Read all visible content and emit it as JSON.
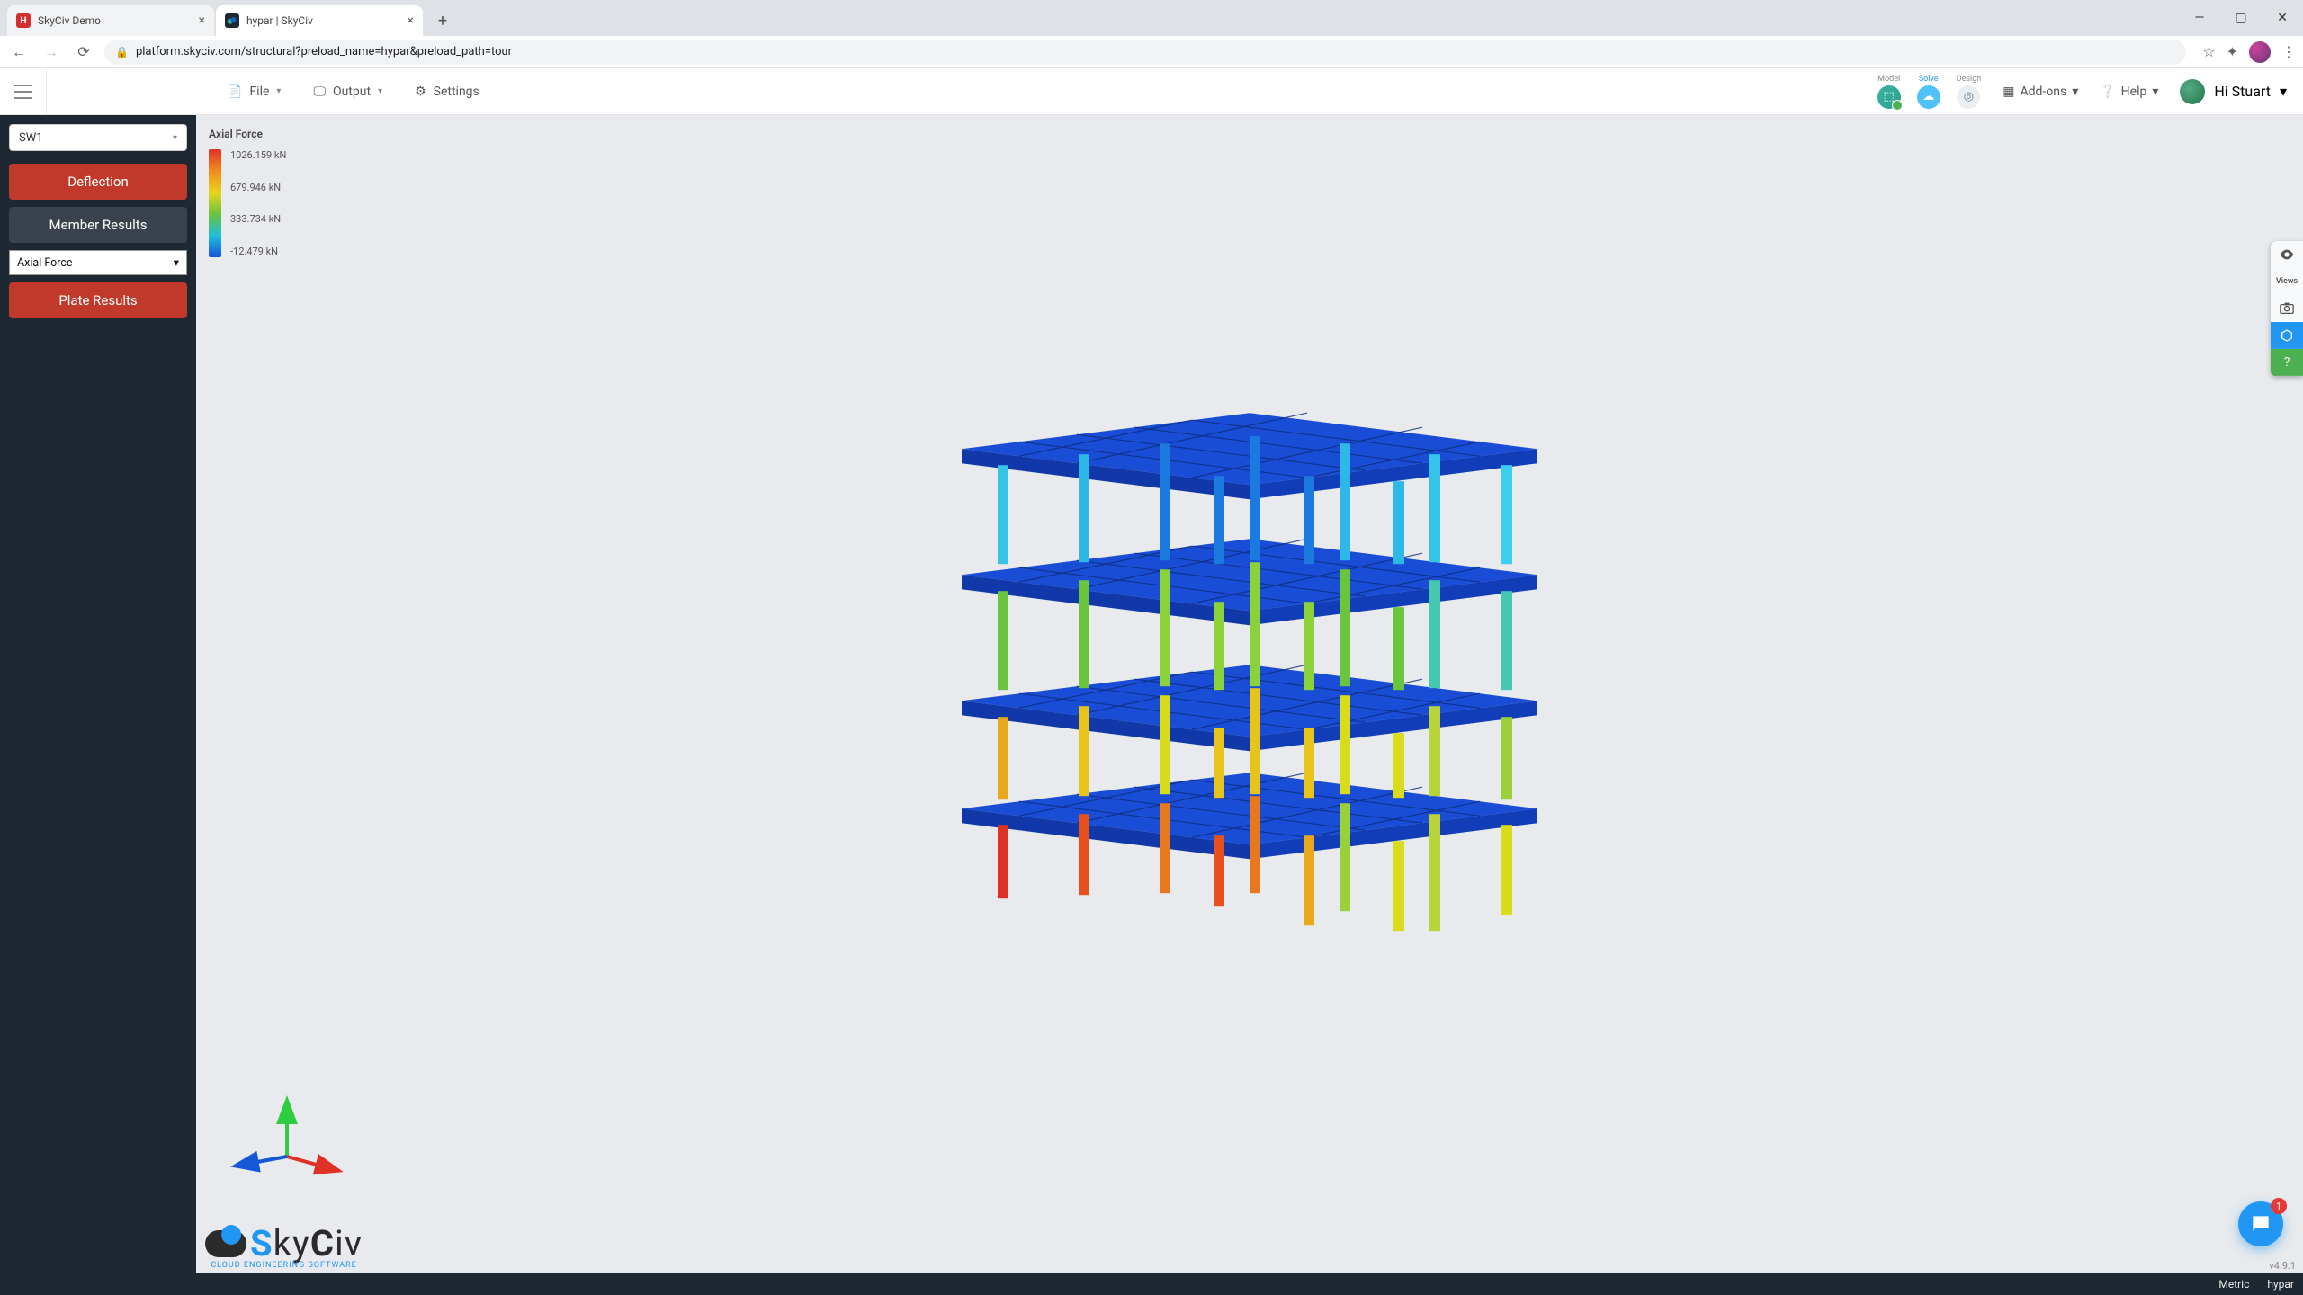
{
  "browser": {
    "tabs": [
      {
        "title": "SkyCiv Demo",
        "favcolor": "#d32f2f",
        "favtxt": "H",
        "active": false
      },
      {
        "title": "hypar | SkyCiv",
        "favcolor": "#1e2833",
        "favtxt": "",
        "active": true
      }
    ],
    "url": "platform.skyciv.com/structural?preload_name=hypar&preload_path=tour"
  },
  "topbar": {
    "menus": {
      "file": "File",
      "output": "Output",
      "settings": "Settings"
    },
    "modes": {
      "model": "Model",
      "solve": "Solve",
      "design": "Design"
    },
    "addons": "Add-ons",
    "help": "Help",
    "greeting": "Hi Stuart"
  },
  "sidebar": {
    "load_combo": "SW1",
    "deflection": "Deflection",
    "member_results": "Member Results",
    "result_type": "Axial Force",
    "plate_results": "Plate Results"
  },
  "legend": {
    "title": "Axial Force",
    "ticks": [
      "1026.159 kN",
      "679.946 kN",
      "333.734 kN",
      "-12.479 kN"
    ]
  },
  "logo": {
    "name": "SkyCiv",
    "tagline": "CLOUD ENGINEERING SOFTWARE"
  },
  "right_tools": {
    "views": "Views"
  },
  "chat_badge": "1",
  "version": "v4.9.1",
  "footer": {
    "units": "Metric",
    "integration": "hypar"
  }
}
